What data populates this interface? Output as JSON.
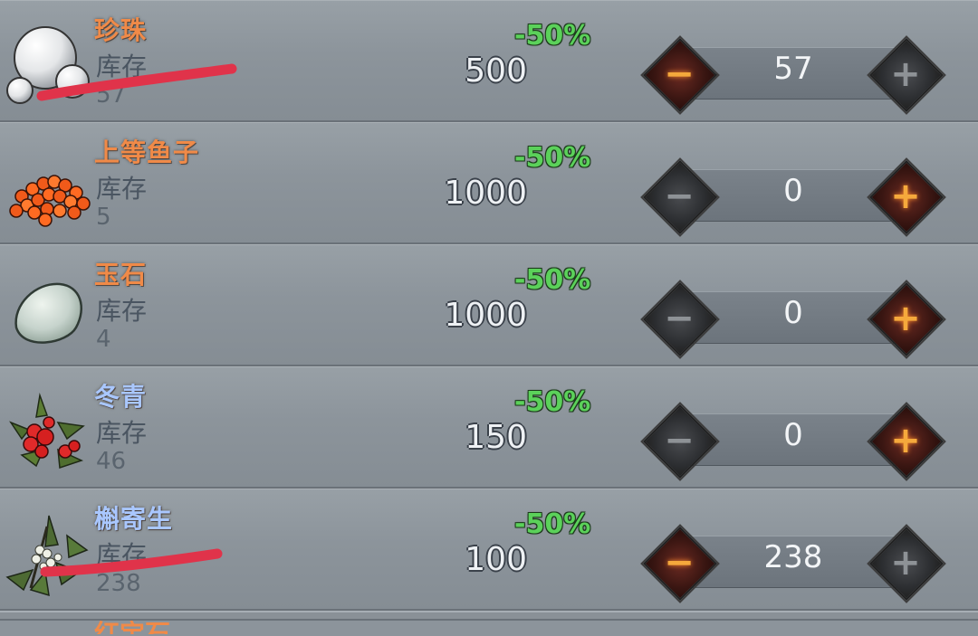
{
  "colors": {
    "name_orange": "#f08a48",
    "name_blue": "#a9c7ff",
    "discount_green": "#5bd15a",
    "active_button": "#f5a93c",
    "scribble_red": "#e0334a"
  },
  "items": [
    {
      "name": "珍珠",
      "name_color": "orange",
      "icon": "pearl-icon",
      "stock_label": "库存",
      "stock": "57",
      "discount": "-50%",
      "price": "500",
      "quantity": "57",
      "minus_active": true,
      "plus_active": false
    },
    {
      "name": "上等鱼子",
      "name_color": "orange",
      "icon": "caviar-icon",
      "stock_label": "库存",
      "stock": "5",
      "discount": "-50%",
      "price": "1000",
      "quantity": "0",
      "minus_active": false,
      "plus_active": true
    },
    {
      "name": "玉石",
      "name_color": "orange",
      "icon": "jade-icon",
      "stock_label": "库存",
      "stock": "4",
      "discount": "-50%",
      "price": "1000",
      "quantity": "0",
      "minus_active": false,
      "plus_active": true
    },
    {
      "name": "冬青",
      "name_color": "blue",
      "icon": "holly-icon",
      "stock_label": "库存",
      "stock": "46",
      "discount": "-50%",
      "price": "150",
      "quantity": "0",
      "minus_active": false,
      "plus_active": true
    },
    {
      "name": "槲寄生",
      "name_color": "blue",
      "icon": "mistletoe-icon",
      "stock_label": "库存",
      "stock": "238",
      "discount": "-50%",
      "price": "100",
      "quantity": "238",
      "minus_active": true,
      "plus_active": false
    }
  ],
  "partial_item": {
    "name": "红宝石"
  },
  "buttons": {
    "minus_glyph": "−",
    "plus_glyph": "+"
  }
}
